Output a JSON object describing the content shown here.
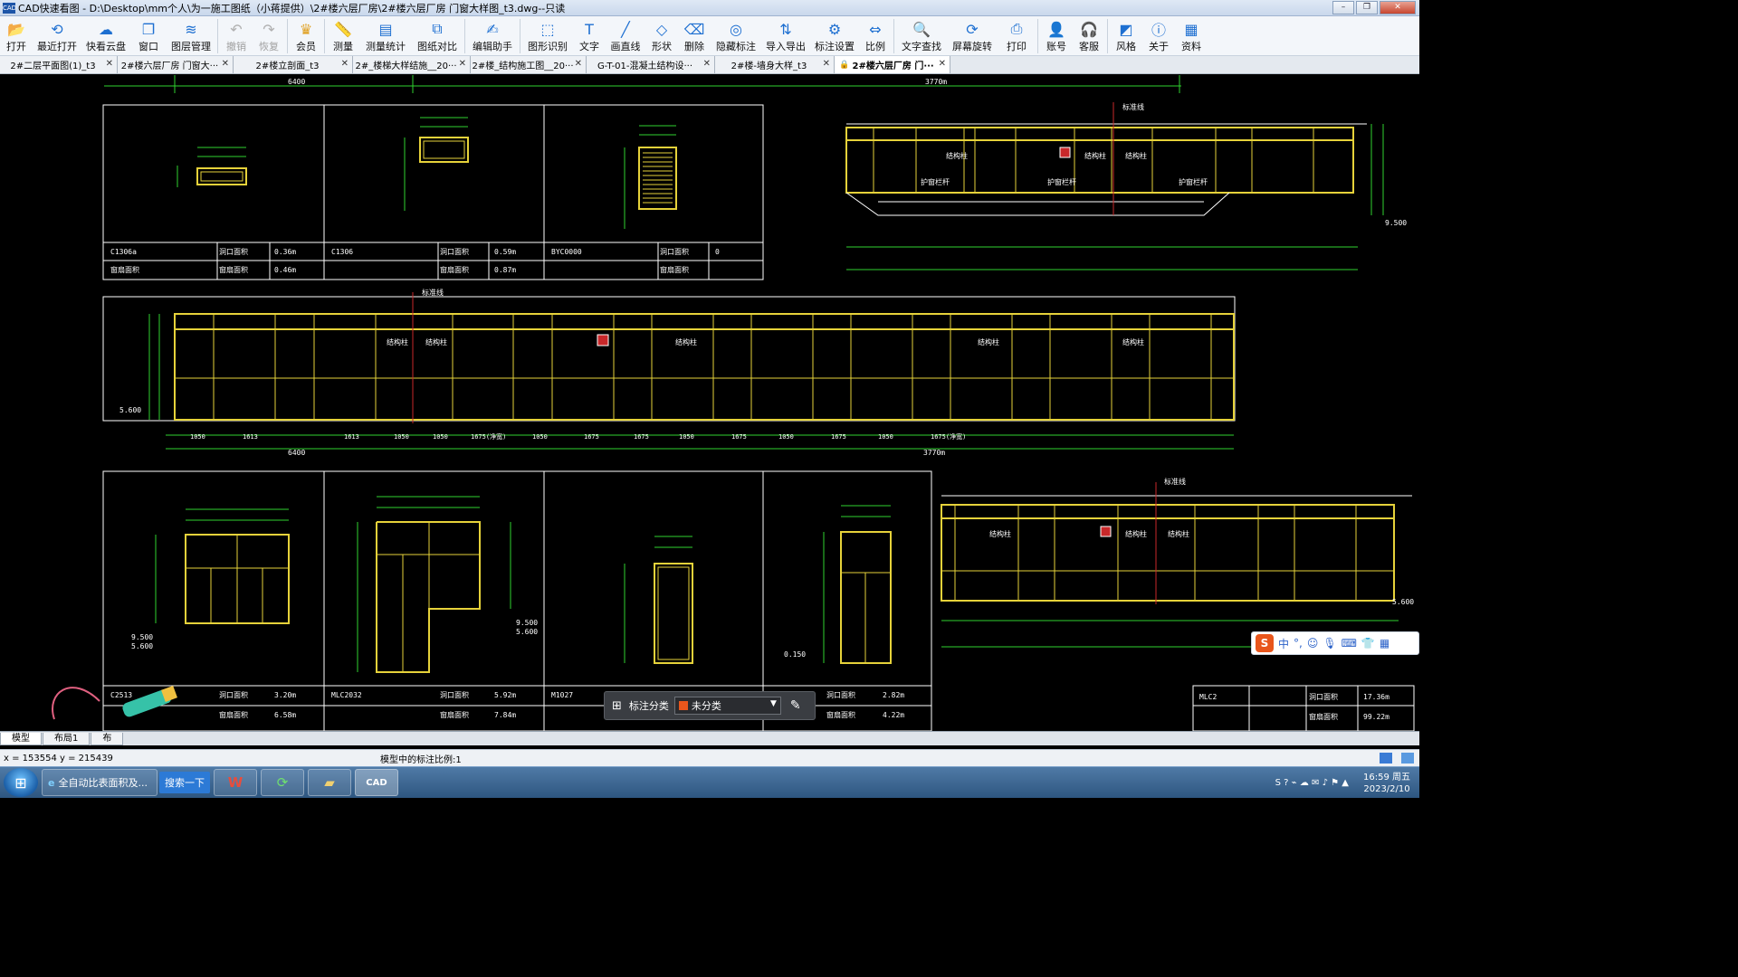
{
  "window": {
    "title": "CAD快速看图 - D:\\Desktop\\mm个人\\为一施工图纸（小蒋提供）\\2#楼六层厂房\\2#楼六层厂房 门窗大样图_t3.dwg--只读",
    "app_icon": "CAD"
  },
  "toolbar": {
    "items": [
      {
        "label": "打开",
        "icon": "folder-open-icon"
      },
      {
        "label": "最近打开",
        "icon": "history-icon"
      },
      {
        "label": "快看云盘",
        "icon": "cloud-icon"
      },
      {
        "label": "窗口",
        "icon": "window-icon"
      },
      {
        "label": "图层管理",
        "icon": "layers-icon"
      },
      {
        "label": "撤销",
        "icon": "undo-icon",
        "disabled": true
      },
      {
        "label": "恢复",
        "icon": "redo-icon",
        "disabled": true
      },
      {
        "label": "会员",
        "icon": "vip-icon"
      },
      {
        "label": "测量",
        "icon": "ruler-icon"
      },
      {
        "label": "测量统计",
        "icon": "measure-stats-icon"
      },
      {
        "label": "图纸对比",
        "icon": "compare-icon"
      },
      {
        "label": "编辑助手",
        "icon": "edit-assistant-icon"
      },
      {
        "label": "图形识别",
        "icon": "shape-recognize-icon"
      },
      {
        "label": "文字",
        "icon": "text-icon"
      },
      {
        "label": "画直线",
        "icon": "line-icon"
      },
      {
        "label": "形状",
        "icon": "shape-icon"
      },
      {
        "label": "删除",
        "icon": "eraser-icon"
      },
      {
        "label": "隐藏标注",
        "icon": "hide-annotation-icon"
      },
      {
        "label": "导入导出",
        "icon": "import-export-icon"
      },
      {
        "label": "标注设置",
        "icon": "annotation-settings-icon"
      },
      {
        "label": "比例",
        "icon": "scale-icon"
      },
      {
        "label": "文字查找",
        "icon": "text-search-icon"
      },
      {
        "label": "屏幕旋转",
        "icon": "rotate-screen-icon"
      },
      {
        "label": "打印",
        "icon": "printer-icon"
      },
      {
        "label": "账号",
        "icon": "account-icon"
      },
      {
        "label": "客服",
        "icon": "headset-icon"
      },
      {
        "label": "风格",
        "icon": "style-icon"
      },
      {
        "label": "关于",
        "icon": "info-icon"
      },
      {
        "label": "资料",
        "icon": "documents-icon"
      }
    ]
  },
  "tabs": [
    {
      "label": "2#二层平面图(1)_t3"
    },
    {
      "label": "2#楼六层厂房 门窗大···"
    },
    {
      "label": "2#楼立剖面_t3"
    },
    {
      "label": "2#_楼梯大样结施__20···"
    },
    {
      "label": "2#楼_结构施工图__20···"
    },
    {
      "label": "G-T-01-混凝土结构设···"
    },
    {
      "label": "2#楼-墙身大样_t3"
    },
    {
      "label": "2#楼六层厂房 门···",
      "active": true
    }
  ],
  "drawing": {
    "top_dims": {
      "left": "6400",
      "right": "3770m"
    },
    "panel1_table": {
      "c1": {
        "code": "C1306a",
        "k1": "洞口面积",
        "v1": "0.36m",
        "k2": "窗扇面积",
        "v2": "0.46m"
      },
      "c2": {
        "code": "C1306",
        "k1": "洞口面积",
        "v1": "0.59m",
        "k2": "窗扇面积",
        "v2": "0.87m"
      },
      "c3": {
        "code": "BYC0000",
        "k1": "洞口面积",
        "v1": "0",
        "k2": "窗扇面积",
        "v2": ""
      }
    },
    "labels": {
      "jgz": "结构柱",
      "hcgl": "护窗栏杆",
      "fzx": "标准线",
      "elev1": "5.600",
      "elev2": "9.500",
      "elev3": "0.150"
    },
    "middle_dims": [
      "1050",
      "1613",
      "1613",
      "1050",
      "1050",
      "1675(净宽)",
      "1050",
      "1675",
      "1675",
      "1050",
      "1675",
      "1050",
      "1675",
      "1050",
      "1675(净宽)"
    ],
    "middle_totals": {
      "left": "6400",
      "right": "3770m"
    },
    "bottom_table": {
      "c1": {
        "code": "C2513",
        "k1": "洞口面积",
        "v1": "3.20m",
        "k2": "窗扇面积",
        "v2": "6.58m"
      },
      "c2": {
        "code": "MLC2032",
        "k1": "洞口面积",
        "v1": "5.92m",
        "k2": "窗扇面积",
        "v2": "7.84m"
      },
      "c3": {
        "code": "M1027",
        "k1": "洞口面积",
        "v1": "2.82m",
        "k2": "窗扇面积",
        "v2": "4.22m"
      },
      "c4": {
        "code": "MLC2",
        "k1": "洞口面积",
        "v1": "17.36m",
        "k2": "窗扇面积",
        "v2": "99.22m"
      }
    }
  },
  "annotation_bar": {
    "label": "标注分类",
    "value": "未分类",
    "swatch_color": "#e8561c"
  },
  "ime": {
    "label": "中"
  },
  "layout_tabs": [
    {
      "label": "模型",
      "active": true
    },
    {
      "label": "布局1"
    },
    {
      "label": "布"
    }
  ],
  "status": {
    "coords": "x = 153554  y = 215439",
    "scale_text": "模型中的标注比例:1"
  },
  "taskbar": {
    "items": [
      {
        "label": "全自动比表面积及..."
      },
      {
        "label": "搜索一下"
      }
    ],
    "clock_time": "16:59 周五",
    "clock_date": "2023/2/10"
  },
  "colors": {
    "frame_yellow": "#e6d23a",
    "dim_green": "#2fd22f",
    "grid_red": "#c8282a",
    "white": "#ffffff"
  }
}
